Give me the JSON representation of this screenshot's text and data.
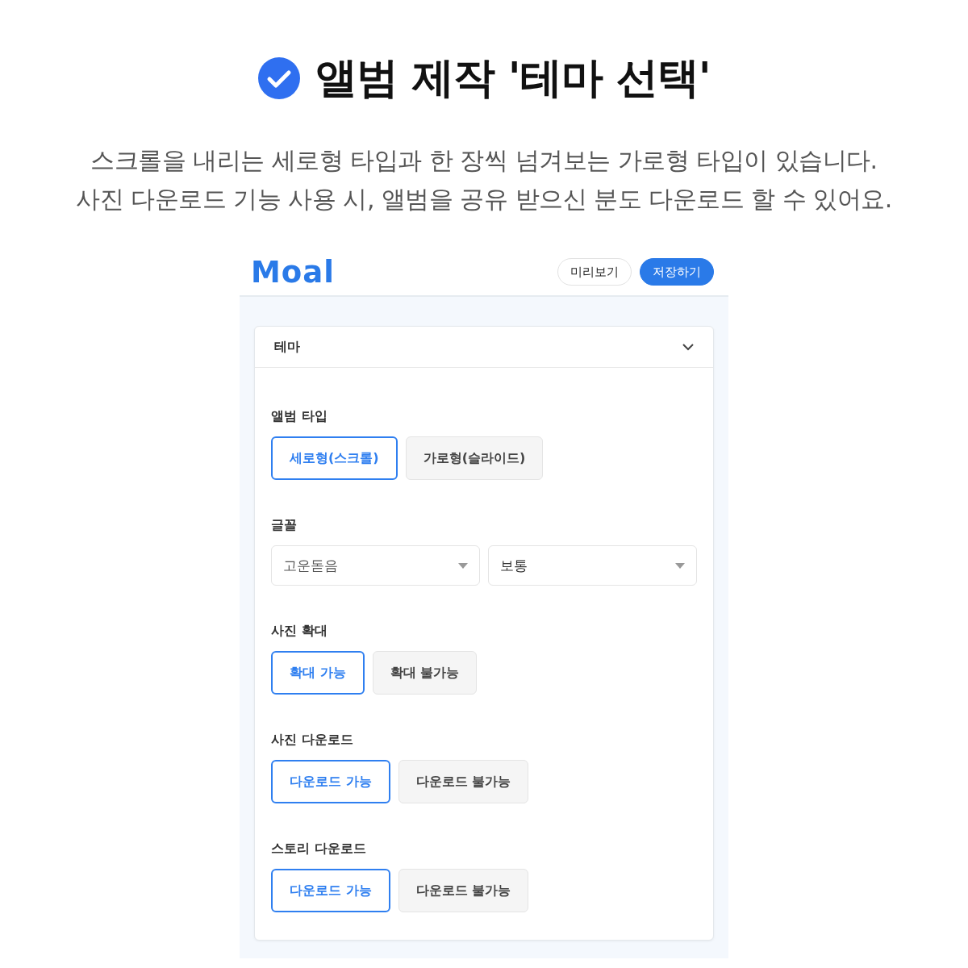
{
  "heading": {
    "title": "앨범 제작 '테마 선택'",
    "lines": [
      "스크롤을 내리는 세로형 타입과 한 장씩 넘겨보는 가로형 타입이 있습니다.",
      "사진 다운로드 기능 사용 시, 앨범을 공유 받으신 분도 다운로드 할 수 있어요."
    ]
  },
  "app": {
    "logo": "Moal",
    "buttons": [
      {
        "label": "미리보기",
        "kind": "outline"
      },
      {
        "label": "저장하기",
        "kind": "primary"
      }
    ],
    "panel": {
      "title": "테마",
      "expanded": true,
      "groups": [
        {
          "kind": "options",
          "label": "앨범 타입",
          "options": [
            {
              "label": "세로형(스크롤)",
              "selected": true
            },
            {
              "label": "가로형(슬라이드)",
              "selected": false
            }
          ]
        },
        {
          "kind": "selects",
          "label": "글꼴",
          "selects": [
            {
              "value": "고운돋음"
            },
            {
              "value": "보통"
            }
          ]
        },
        {
          "kind": "options",
          "label": "사진 확대",
          "options": [
            {
              "label": "확대 가능",
              "selected": true
            },
            {
              "label": "확대 불가능",
              "selected": false
            }
          ]
        },
        {
          "kind": "options",
          "label": "사진 다운로드",
          "options": [
            {
              "label": "다운로드 가능",
              "selected": true
            },
            {
              "label": "다운로드 불가능",
              "selected": false
            }
          ]
        },
        {
          "kind": "options",
          "label": "스토리 다운로드",
          "options": [
            {
              "label": "다운로드 가능",
              "selected": true
            },
            {
              "label": "다운로드 불가능",
              "selected": false
            }
          ]
        }
      ]
    }
  }
}
